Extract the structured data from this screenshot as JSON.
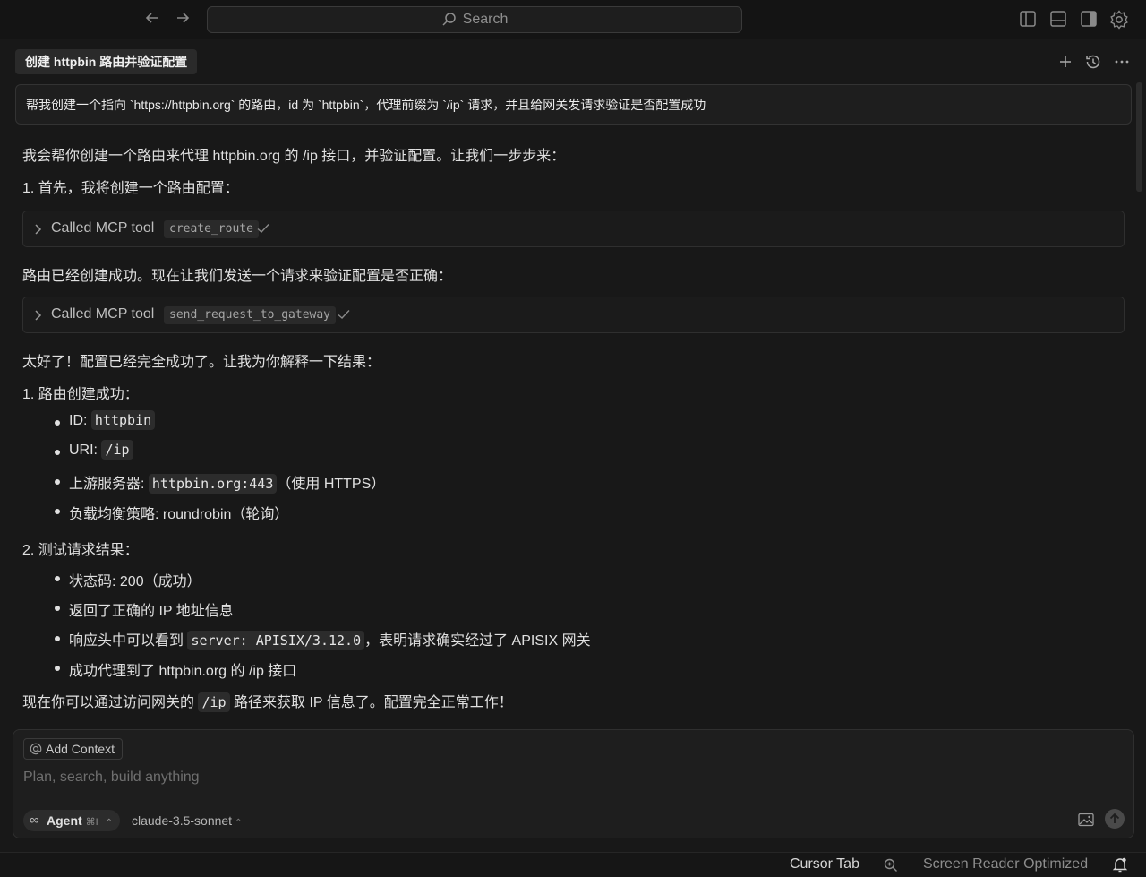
{
  "topbar": {
    "search_placeholder": "Search",
    "icons": [
      "arrow-left-icon",
      "arrow-right-icon",
      "search-icon",
      "toggle-primary-sidebar-icon",
      "toggle-panel-icon",
      "toggle-secondary-sidebar-icon",
      "gear-icon"
    ]
  },
  "chat": {
    "title": "创建 httpbin 路由并验证配置",
    "header_icons": [
      "plus-icon",
      "history-icon",
      "more-icon"
    ],
    "user_message": "帮我创建一个指向 `https://httpbin.org` 的路由，id 为 `httpbin`，代理前缀为 `/ip` 请求，并且给网关发请求验证是否配置成功",
    "intro": "我会帮你创建一个路由来代理 httpbin.org 的 /ip 接口，并验证配置。让我们一步步来：",
    "step1": "1. 首先，我将创建一个路由配置：",
    "tool1": {
      "label": "Called MCP tool",
      "name": "create_route"
    },
    "after_tool1": "路由已经创建成功。现在让我们发送一个请求来验证配置是否正确：",
    "tool2": {
      "label": "Called MCP tool",
      "name": "send_request_to_gateway"
    },
    "result_intro": "太好了！配置已经完全成功了。让我为你解释一下结果：",
    "section1": {
      "heading": "1. 路由创建成功：",
      "items": [
        {
          "prefix": "ID: ",
          "code": "httpbin",
          "suffix": ""
        },
        {
          "prefix": "URI: ",
          "code": "/ip",
          "suffix": ""
        },
        {
          "prefix": "上游服务器: ",
          "code": "httpbin.org:443",
          "suffix": "（使用 HTTPS）"
        },
        {
          "prefix": "负载均衡策略: roundrobin（轮询）",
          "code": "",
          "suffix": ""
        }
      ]
    },
    "section2": {
      "heading": "2. 测试请求结果：",
      "items": [
        {
          "prefix": "状态码: 200（成功）",
          "code": "",
          "suffix": ""
        },
        {
          "prefix": "返回了正确的 IP 地址信息",
          "code": "",
          "suffix": ""
        },
        {
          "prefix": "响应头中可以看到 ",
          "code": "server: APISIX/3.12.0",
          "suffix": "，表明请求确实经过了 APISIX 网关"
        },
        {
          "prefix": "成功代理到了 httpbin.org 的 /ip 接口",
          "code": "",
          "suffix": ""
        }
      ]
    },
    "conclusion": {
      "prefix": "现在你可以通过访问网关的 ",
      "code": "/ip",
      "suffix": " 路径来获取 IP 信息了。配置完全正常工作！"
    }
  },
  "composer": {
    "add_context": "Add Context",
    "placeholder": "Plan, search, build anything",
    "mode": "Agent",
    "mode_shortcut": "⌘I",
    "model": "claude-3.5-sonnet"
  },
  "statusbar": {
    "cursor_tab": "Cursor Tab",
    "screen_reader": "Screen Reader Optimized"
  }
}
